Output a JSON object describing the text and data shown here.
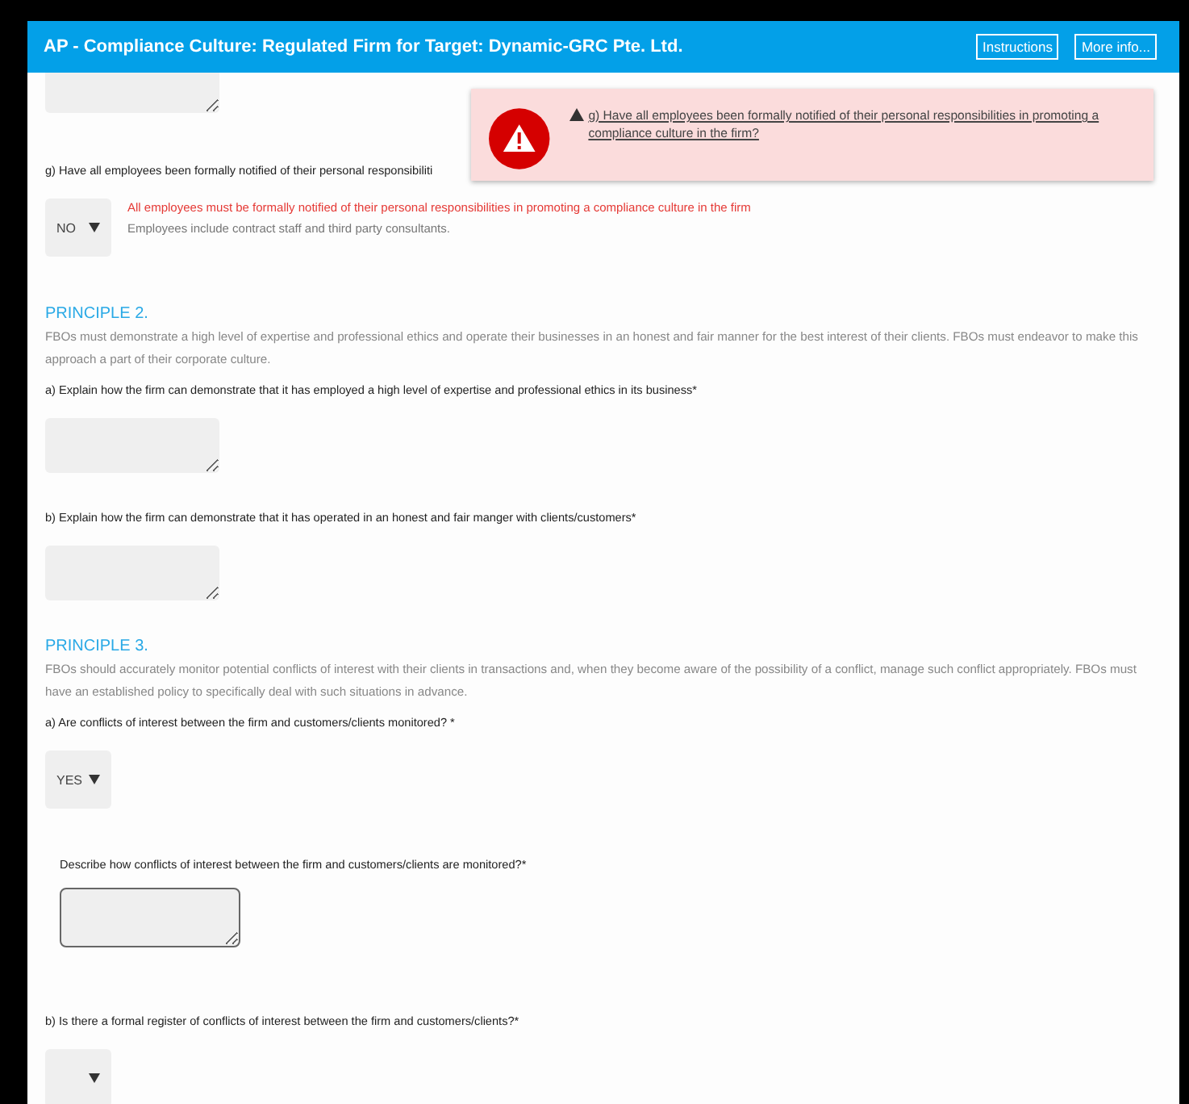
{
  "header": {
    "title": "AP - Compliance Culture: Regulated Firm for Target: Dynamic-GRC Pte. Ltd.",
    "buttons": [
      "Instructions",
      "More info..."
    ]
  },
  "alert": {
    "message": "g) Have all employees been formally notified of their personal responsibilities in promoting a compliance culture in the firm?"
  },
  "items": [
    {
      "kind": "textarea",
      "indented": false
    },
    {
      "kind": "question",
      "text": "g) Have all employees been formally notified of their personal responsibiliti"
    },
    {
      "kind": "select",
      "value": "NO",
      "error": "All employees must be formally notified of their personal responsibilities in promoting a compliance culture in the firm",
      "hint": "Employees include contract staff and third party consultants."
    },
    {
      "kind": "principle",
      "title": "PRINCIPLE 2.",
      "text": "FBOs must demonstrate a high level of expertise and professional ethics and operate their businesses in an honest and fair manner for the best interest of their clients. FBOs must endeavor to make this approach a part of their corporate culture."
    },
    {
      "kind": "question",
      "text": "a) Explain how the firm can demonstrate that it has employed a high level of expertise and professional ethics in its business*"
    },
    {
      "kind": "textarea",
      "indented": false
    },
    {
      "kind": "question",
      "text": "b) Explain how the firm can demonstrate that it has operated in an honest and fair manger with clients/customers*"
    },
    {
      "kind": "textarea",
      "indented": false
    },
    {
      "kind": "principle",
      "title": "PRINCIPLE 3.",
      "text": "FBOs should accurately monitor potential conflicts of interest with their clients in transactions and, when they become aware of the possibility of a conflict, manage such conflict appropriately. FBOs must have an established policy to specifically deal with such situations in advance."
    },
    {
      "kind": "question",
      "text": "a) Are conflicts of interest between the firm and customers/clients monitored? *"
    },
    {
      "kind": "select",
      "value": "YES"
    },
    {
      "kind": "subquestion",
      "text": "Describe how conflicts of interest between the firm and customers/clients are monitored?*"
    },
    {
      "kind": "textarea",
      "indented": true
    },
    {
      "kind": "question",
      "text": "b) Is there a formal register of conflicts of interest between the firm and customers/clients?*"
    },
    {
      "kind": "select"
    }
  ]
}
